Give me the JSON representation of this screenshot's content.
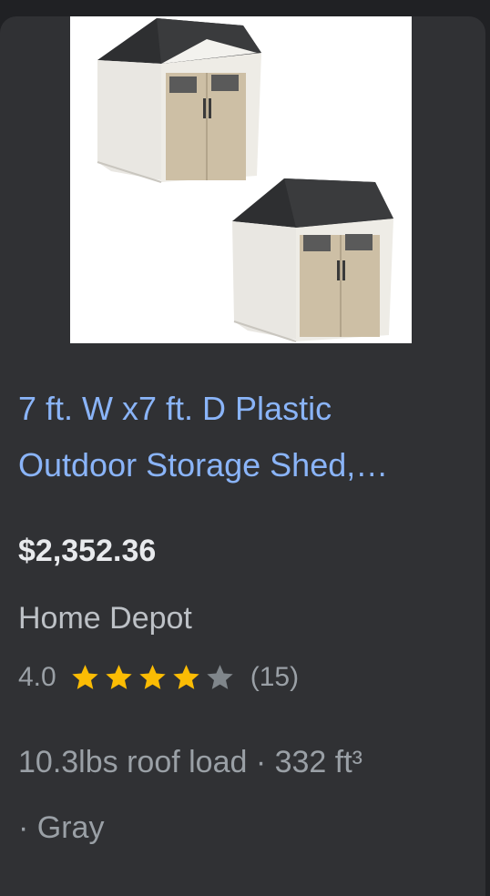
{
  "product": {
    "image_icon": "storage-shed-product-image",
    "title_line1": "7 ft. W x7 ft. D Plastic",
    "title_line2": "Outdoor Storage Shed,…",
    "price": "$2,352.36",
    "merchant": "Home Depot",
    "rating": "4.0",
    "stars_filled": 4,
    "stars_total": 5,
    "review_count": "(15)",
    "attributes_line1": "10.3lbs roof load · 332 ft³",
    "attributes_line2": "· Gray"
  },
  "colors": {
    "title_link": "#8ab4f8",
    "star_filled": "#fbbc04",
    "star_empty": "#80868b",
    "card_bg": "#303134"
  }
}
